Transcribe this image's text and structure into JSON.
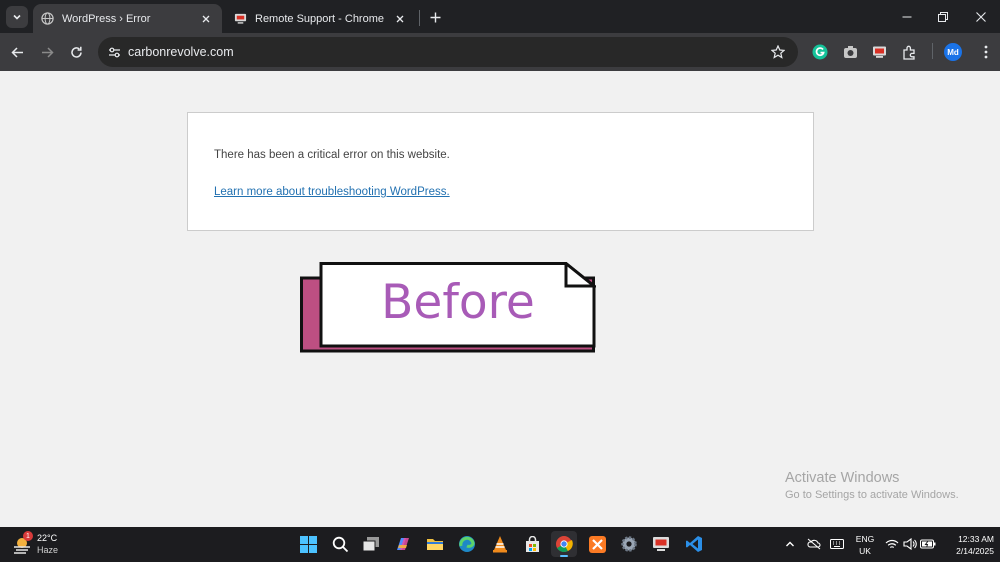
{
  "browser": {
    "tabs": [
      {
        "title": "WordPress › Error",
        "active": true,
        "favicon": "globe-icon"
      },
      {
        "title": "Remote Support - Chrome Remote Desktop",
        "active": false,
        "favicon": "remote-desktop-icon"
      }
    ],
    "url": "carbonrevolve.com",
    "profile_initials": "Md"
  },
  "page": {
    "error_message": "There has been a critical error on this website.",
    "link_text": "Learn more about troubleshooting WordPress.",
    "badge_text": "Before",
    "badge_colors": {
      "shadow": "#bd4f82",
      "text": "#a85bb7",
      "border": "#111111"
    }
  },
  "watermark": {
    "title": "Activate Windows",
    "subtitle": "Go to Settings to activate Windows."
  },
  "taskbar": {
    "weather": {
      "temp": "22°C",
      "condition": "Haze",
      "alert_count": "1"
    },
    "apps": [
      "start",
      "search",
      "task-view",
      "copilot",
      "file-explorer",
      "edge",
      "vlc",
      "store",
      "chrome",
      "xampp",
      "settings",
      "remote-desktop",
      "vscode"
    ],
    "language": {
      "line1": "ENG",
      "line2": "UK"
    },
    "time": "12:33 AM",
    "date": "2/14/2025"
  }
}
